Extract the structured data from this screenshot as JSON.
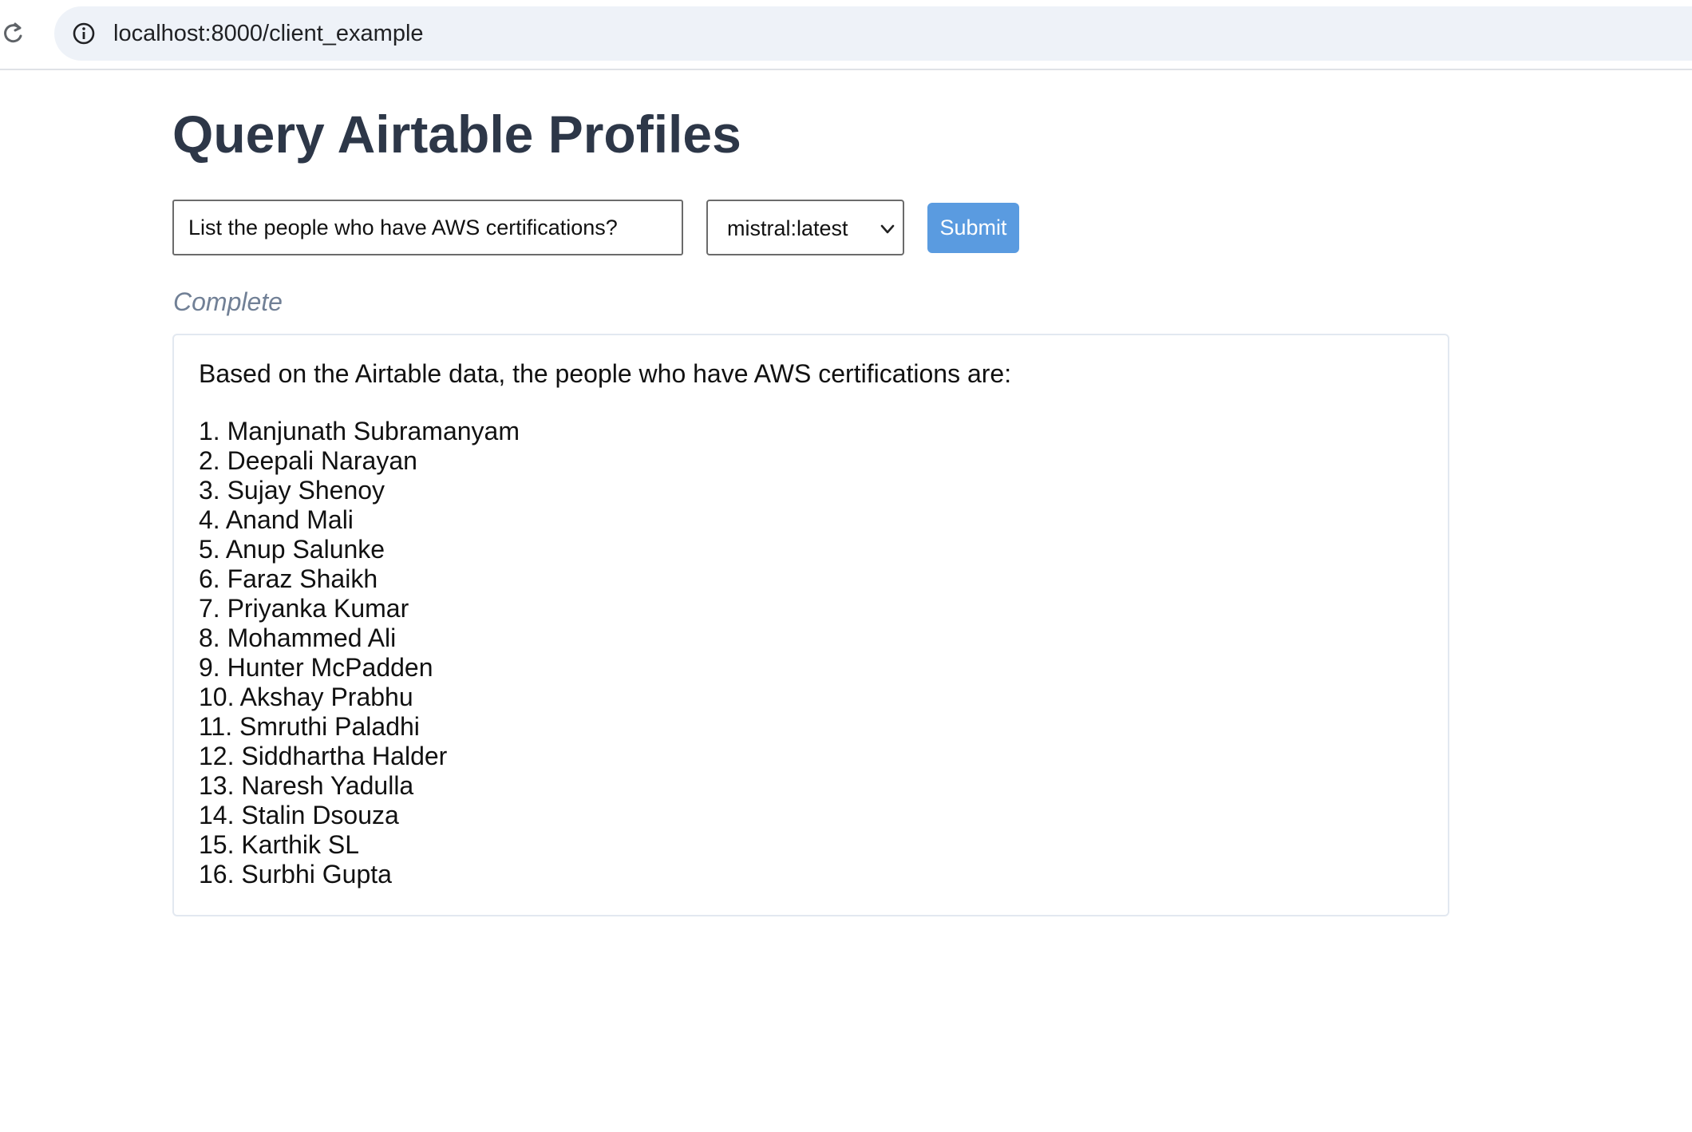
{
  "browser": {
    "url": "localhost:8000/client_example",
    "icons": {
      "reload": "reload-icon",
      "info": "info-icon"
    }
  },
  "page": {
    "title": "Query Airtable Profiles",
    "query_input": {
      "value": "List the people who have AWS certifications?"
    },
    "model_select": {
      "value": "mistral:latest"
    },
    "submit_label": "Submit",
    "status": "Complete",
    "result": {
      "intro": "Based on the Airtable data, the people who have AWS certifications are:",
      "items": [
        "1. Manjunath Subramanyam",
        "2. Deepali Narayan",
        "3. Sujay Shenoy",
        "4. Anand Mali",
        "5. Anup Salunke",
        "6. Faraz Shaikh",
        "7. Priyanka Kumar",
        "8. Mohammed Ali",
        "9. Hunter McPadden",
        "10. Akshay Prabhu",
        "11. Smruthi Paladhi",
        "12. Siddhartha Halder",
        "13. Naresh Yadulla",
        "14. Stalin Dsouza",
        "15. Karthik SL",
        "16. Surbhi Gupta"
      ]
    }
  },
  "colors": {
    "title": "#2d3748",
    "status": "#718096",
    "submit_bg": "#5a9be0",
    "omnibox_bg": "#eef2f8",
    "result_border": "#e2e8f0"
  }
}
